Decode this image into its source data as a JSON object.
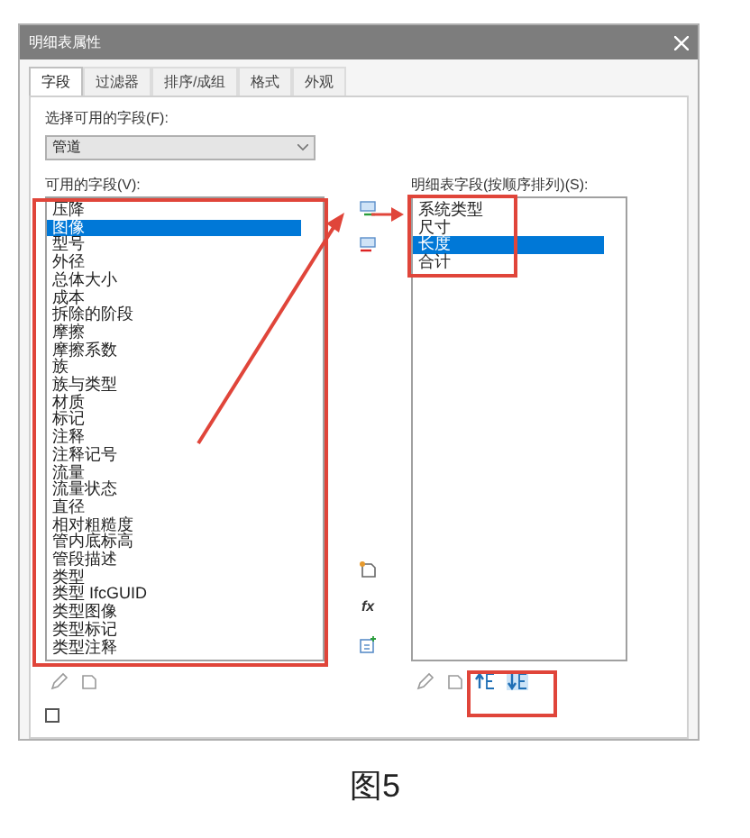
{
  "window": {
    "title": "明细表属性"
  },
  "tabs": [
    {
      "label": "字段",
      "selected": true
    },
    {
      "label": "过滤器",
      "selected": false
    },
    {
      "label": "排序/成组",
      "selected": false
    },
    {
      "label": "格式",
      "selected": false
    },
    {
      "label": "外观",
      "selected": false
    }
  ],
  "category": {
    "label": "选择可用的字段(F):",
    "value": "管道"
  },
  "available": {
    "label": "可用的字段(V):",
    "items": [
      {
        "label": "压降",
        "selected": false
      },
      {
        "label": "图像",
        "selected": true
      },
      {
        "label": "型号",
        "selected": false
      },
      {
        "label": "外径",
        "selected": false
      },
      {
        "label": "总体大小",
        "selected": false
      },
      {
        "label": "成本",
        "selected": false
      },
      {
        "label": "拆除的阶段",
        "selected": false
      },
      {
        "label": "摩擦",
        "selected": false
      },
      {
        "label": "摩擦系数",
        "selected": false
      },
      {
        "label": "族",
        "selected": false
      },
      {
        "label": "族与类型",
        "selected": false
      },
      {
        "label": "材质",
        "selected": false
      },
      {
        "label": "标记",
        "selected": false
      },
      {
        "label": "注释",
        "selected": false
      },
      {
        "label": "注释记号",
        "selected": false
      },
      {
        "label": "流量",
        "selected": false
      },
      {
        "label": "流量状态",
        "selected": false
      },
      {
        "label": "直径",
        "selected": false
      },
      {
        "label": "相对粗糙度",
        "selected": false
      },
      {
        "label": "管内底标高",
        "selected": false
      },
      {
        "label": "管段描述",
        "selected": false
      },
      {
        "label": "类型",
        "selected": false
      },
      {
        "label": "类型 IfcGUID",
        "selected": false
      },
      {
        "label": "类型图像",
        "selected": false
      },
      {
        "label": "类型标记",
        "selected": false
      },
      {
        "label": "类型注释",
        "selected": false
      }
    ]
  },
  "scheduled": {
    "label": "明细表字段(按顺序排列)(S):",
    "items": [
      {
        "label": "系统类型",
        "selected": false
      },
      {
        "label": "尺寸",
        "selected": false
      },
      {
        "label": "长度",
        "selected": true
      },
      {
        "label": "合计",
        "selected": false
      }
    ]
  },
  "include_linked": {
    "checked": false
  },
  "formula_button": {
    "label": "fx"
  },
  "caption": "图5"
}
